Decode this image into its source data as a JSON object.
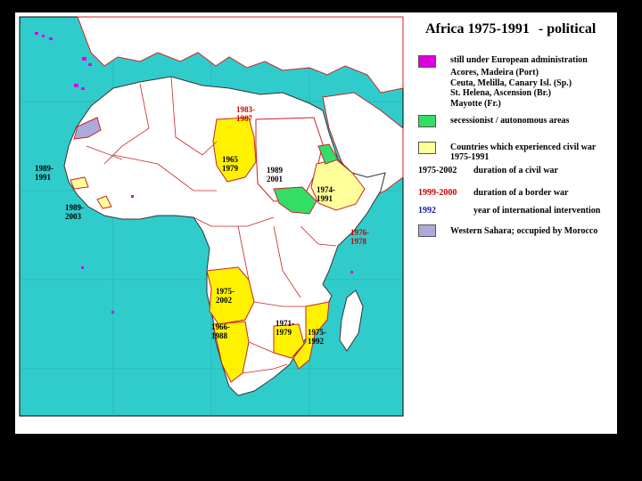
{
  "title": {
    "main": "Africa 1975-1991",
    "suffix": "- political"
  },
  "colors": {
    "background": "#000000",
    "ocean": "#30cccc",
    "land": "#ffffff",
    "border": "#cc2222",
    "civil_war": "#fff200",
    "secessionist": "#33dd66",
    "european": "#dd00dd",
    "western_sahara": "#aaaadd",
    "light_yellow": "#ffff99"
  },
  "legend": {
    "european": {
      "label": "still under European administration",
      "items": [
        "Acores, Madeira (Port)",
        "Ceuta, Melilla, Canary Isl. (Sp.)",
        "St. Helena, Ascension (Br.)",
        "Mayotte (Fr.)"
      ]
    },
    "secessionist": {
      "label": "secessionist / autonomous areas"
    },
    "civil_war": {
      "line1": "Countries which experienced civil war",
      "line2": "1975-1991"
    },
    "example_civil": {
      "years": "1975-2002",
      "text": "duration of a civil war"
    },
    "example_border": {
      "years": "1999-2000",
      "text": "duration of a border war"
    },
    "example_intervention": {
      "years": "1992",
      "text": "year of international intervention"
    },
    "western_sahara": {
      "label": "Western Sahara; occupied by Morocco"
    }
  },
  "map_labels": {
    "libya_chad": {
      "l1": "1983-",
      "l2": "1987"
    },
    "chad": {
      "l1": "1965",
      "l2": "1979"
    },
    "sudan": {
      "l1": "1989",
      "l2": "2001"
    },
    "ethiopia": {
      "l1": "1974-",
      "l2": "1991"
    },
    "senegal": {
      "l1": "1989-",
      "l2": "1991"
    },
    "liberia": {
      "l1": "1989-",
      "l2": "2003"
    },
    "somalia": {
      "l1": "1976-",
      "l2": "1978"
    },
    "angola": {
      "l1": "1975-",
      "l2": "2002"
    },
    "namibia": {
      "l1": "1966-",
      "l2": "1988"
    },
    "zimbabwe": {
      "l1": "1971-",
      "l2": "1979"
    },
    "mozambique": {
      "l1": "1975-",
      "l2": "1992"
    }
  }
}
